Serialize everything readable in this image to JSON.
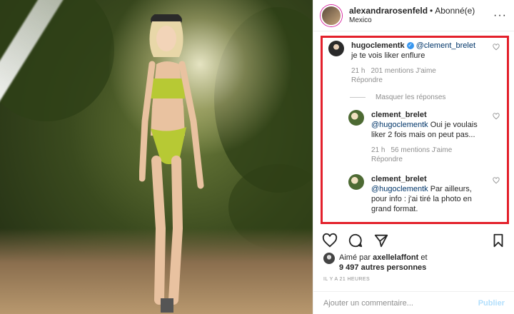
{
  "header": {
    "username": "alexandrarosenfeld",
    "separator": "•",
    "follow_status": "Abonné(e)",
    "location": "Mexico",
    "more_icon": "more-horizontal-icon"
  },
  "comments": [
    {
      "username": "hugoclementk",
      "verified": true,
      "mention": "@clement_brelet",
      "text": "je te vois liker enflure",
      "time": "21 h",
      "likes": "201 mentions J'aime",
      "reply_label": "Répondre"
    }
  ],
  "hide_replies_label": "Masquer les réponses",
  "replies": [
    {
      "username": "clement_brelet",
      "mention": "@hugoclementk",
      "text": "Oui je voulais liker 2 fois mais on peut pas...",
      "time": "21 h",
      "likes": "56 mentions J'aime",
      "reply_label": "Répondre"
    },
    {
      "username": "clement_brelet",
      "mention": "@hugoclementk",
      "text": "Par ailleurs, pour info : j'ai tiré la photo en grand format."
    }
  ],
  "likes_summary": {
    "prefix": "Aimé par",
    "first_liker": "axellelaffont",
    "and": "et",
    "others": "9 497 autres personnes"
  },
  "timestamp": "IL Y A 21 HEURES",
  "add_comment": {
    "placeholder": "Ajouter un commentaire...",
    "publish_label": "Publier"
  },
  "colors": {
    "highlight_border": "#e3202b",
    "verified": "#3897f0",
    "publish_disabled": "#b2dffc"
  }
}
